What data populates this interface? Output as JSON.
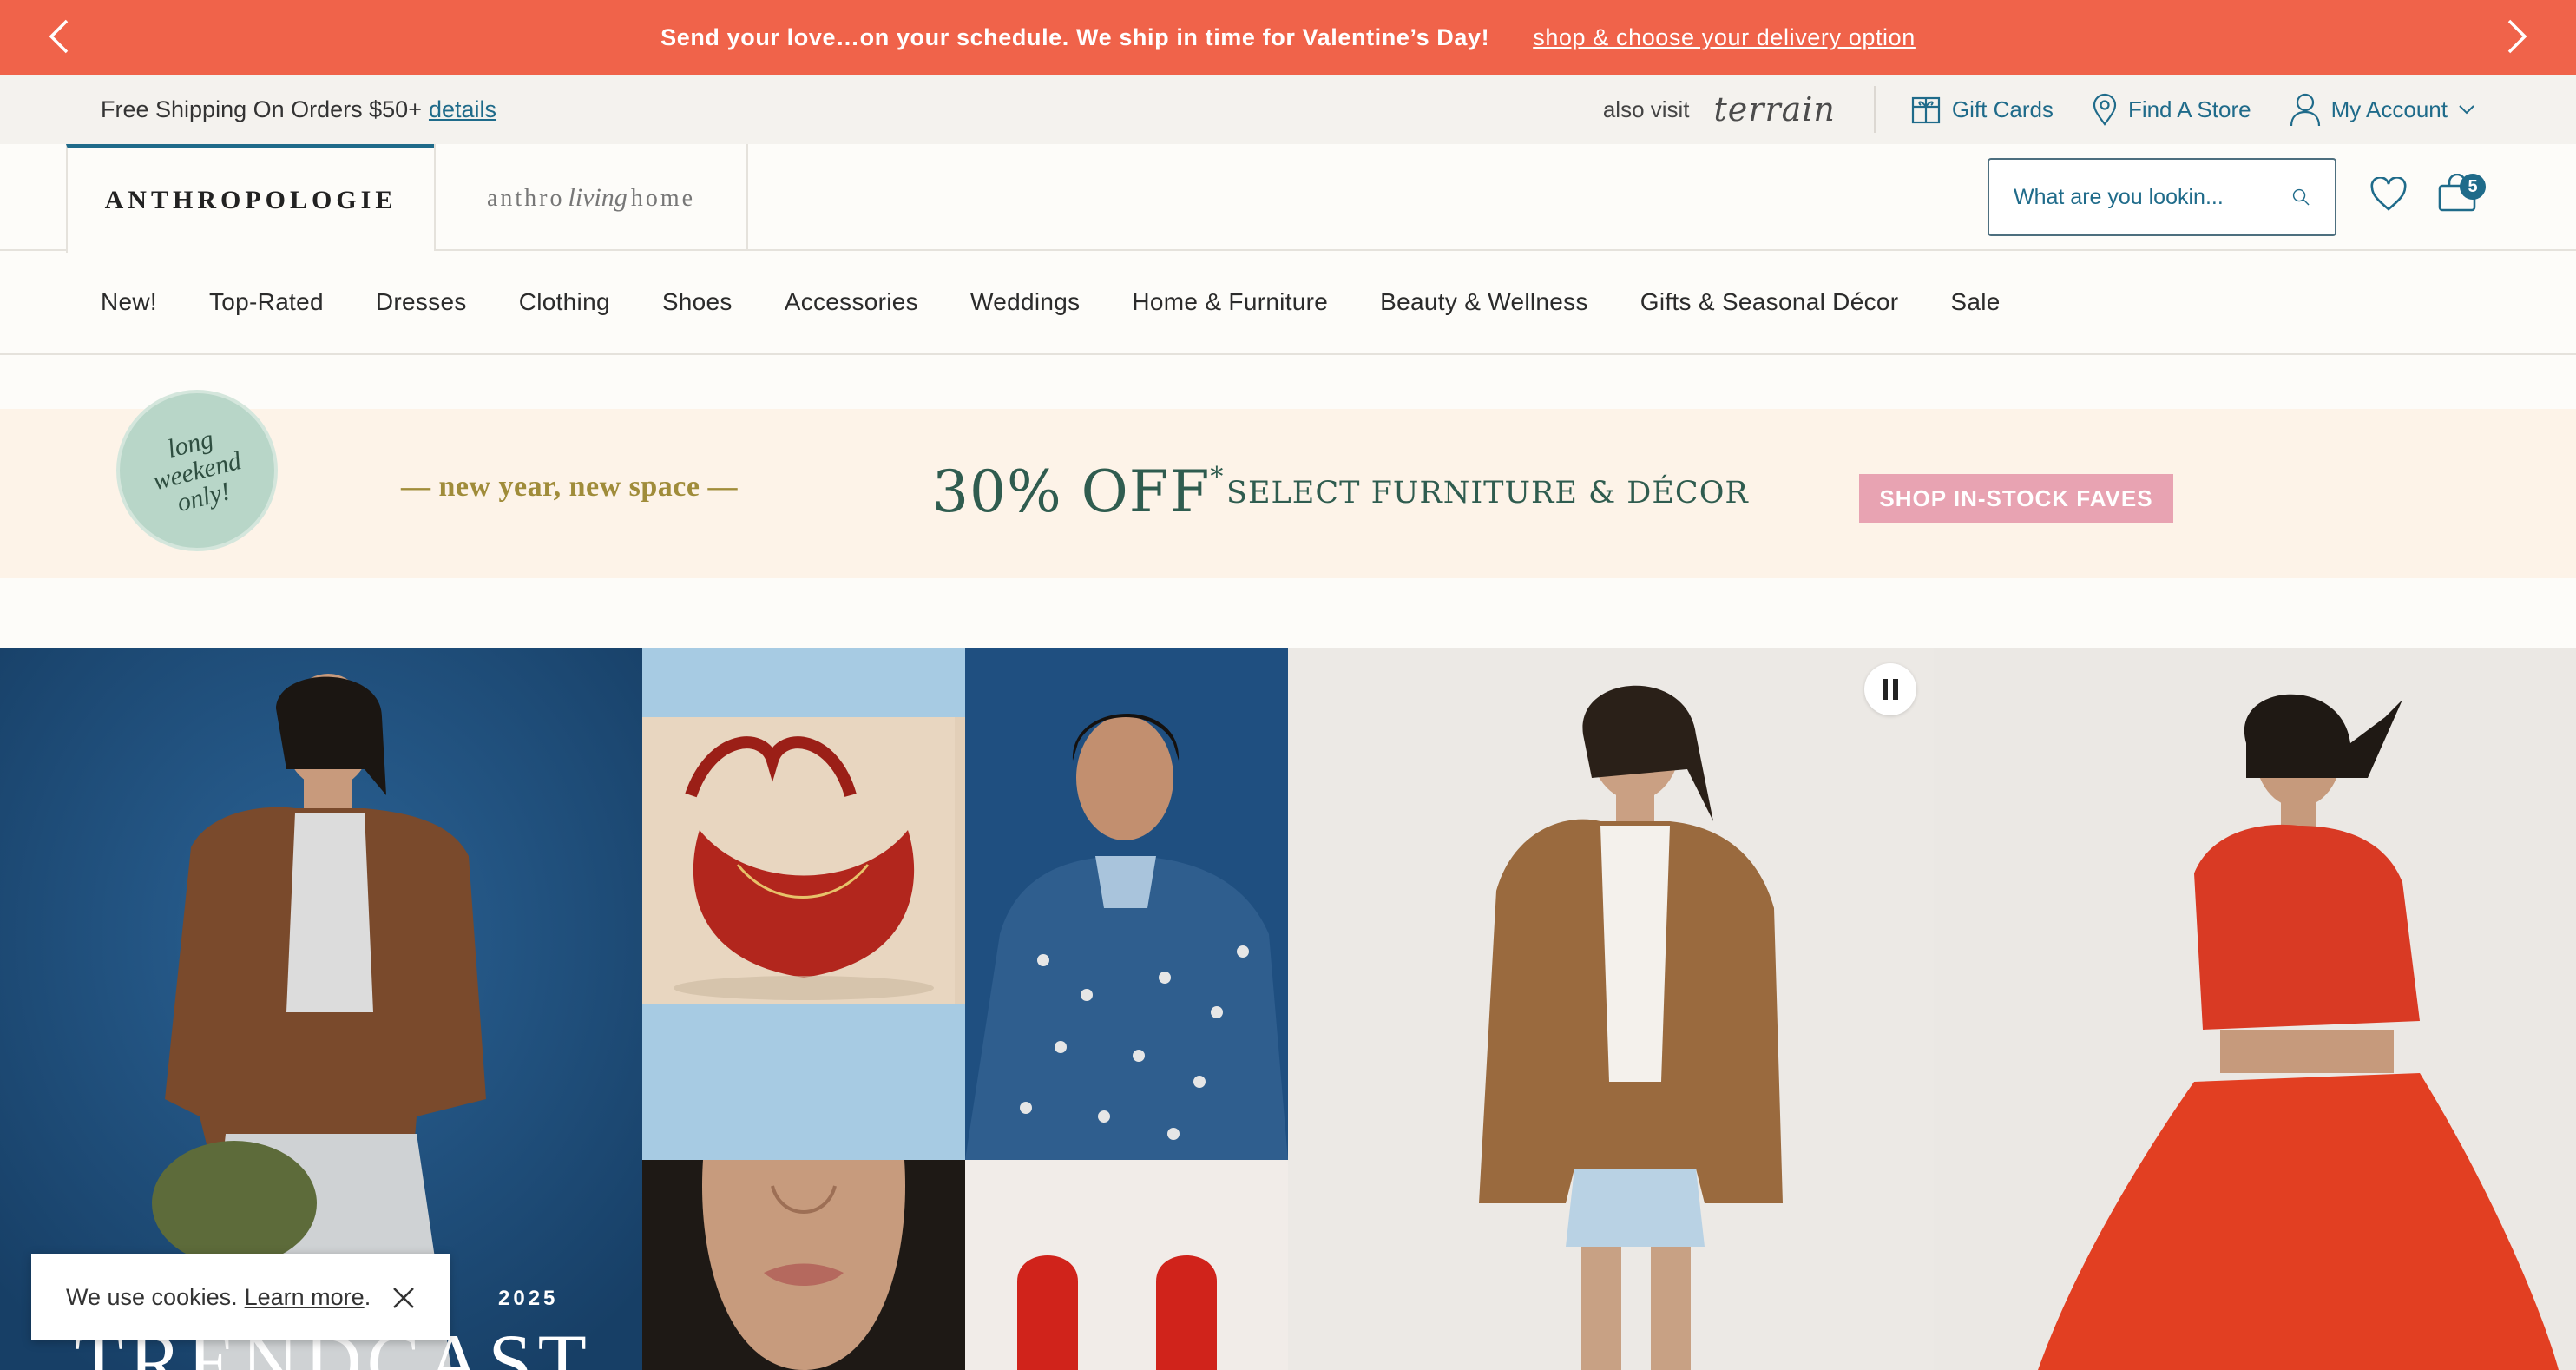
{
  "promo": {
    "message": "Send your love…on your schedule. We ship in time for Valentine’s Day!",
    "link": "shop & choose your delivery option",
    "bg_color": "#f0634a"
  },
  "utility": {
    "free_shipping": "Free Shipping On Orders $50+",
    "details": "details",
    "also_visit": "also visit",
    "terrain": "terrain",
    "gift_cards": "Gift Cards",
    "find_store": "Find A Store",
    "my_account": "My Account"
  },
  "header": {
    "brand_primary": "ANTHROPOLOGIE",
    "brand_living_left": "anthro",
    "brand_living_mid": "living",
    "brand_living_right": "home",
    "search_placeholder": "What are you lookin...",
    "cart_count": "5",
    "accent_color": "#1f6b8a"
  },
  "nav": {
    "items": [
      "New!",
      "Top-Rated",
      "Dresses",
      "Clothing",
      "Shoes",
      "Accessories",
      "Weddings",
      "Home & Furniture",
      "Beauty & Wellness",
      "Gifts & Seasonal Décor",
      "Sale"
    ]
  },
  "banner": {
    "badge": "long weekend only!",
    "tagline": "— new year, new space —",
    "offer": "30% OFF",
    "offer_mark": "*",
    "offer_sub": "SELECT FURNITURE & DÉCOR",
    "cta": "SHOP IN-STOCK FAVES"
  },
  "hero": {
    "year": "2025",
    "title": "TRENDCAST"
  },
  "cookie": {
    "text": "We use cookies.",
    "link": "Learn more",
    "suffix": "."
  }
}
